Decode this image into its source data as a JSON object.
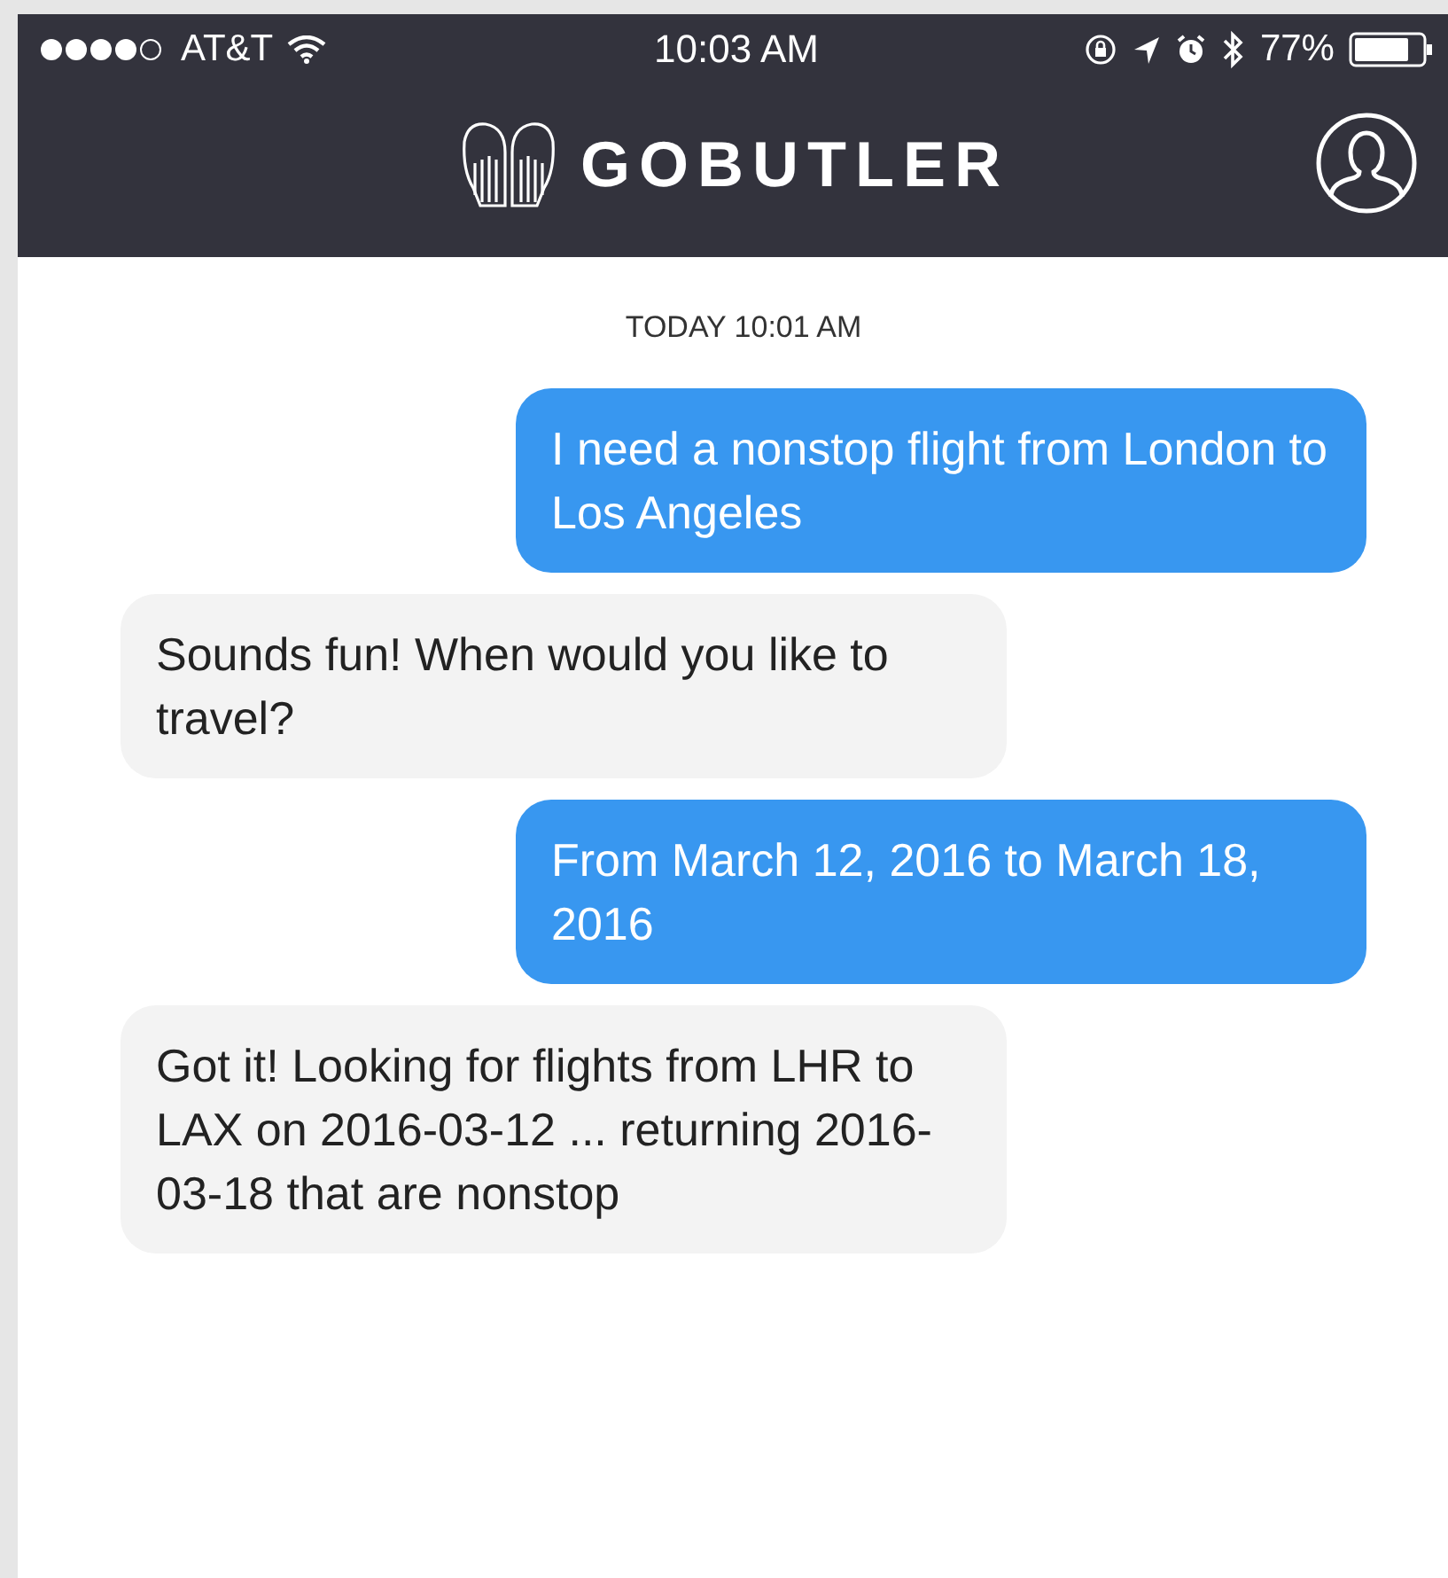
{
  "status_bar": {
    "carrier": "AT&T",
    "time": "10:03 AM",
    "battery": "77%"
  },
  "header": {
    "title": "GOBUTLER"
  },
  "chat": {
    "timestamp": "TODAY 10:01 AM",
    "messages": [
      {
        "kind": "sent",
        "text": "I need a nonstop flight from London to Los Angeles"
      },
      {
        "kind": "received",
        "text": "Sounds fun! When would you like to travel?"
      },
      {
        "kind": "sent",
        "text": "From March 12, 2016 to March 18, 2016"
      },
      {
        "kind": "received",
        "text": "Got it! Looking for flights from LHR to LAX on 2016-03-12 ... returning 2016-03-18 that are nonstop"
      }
    ]
  }
}
